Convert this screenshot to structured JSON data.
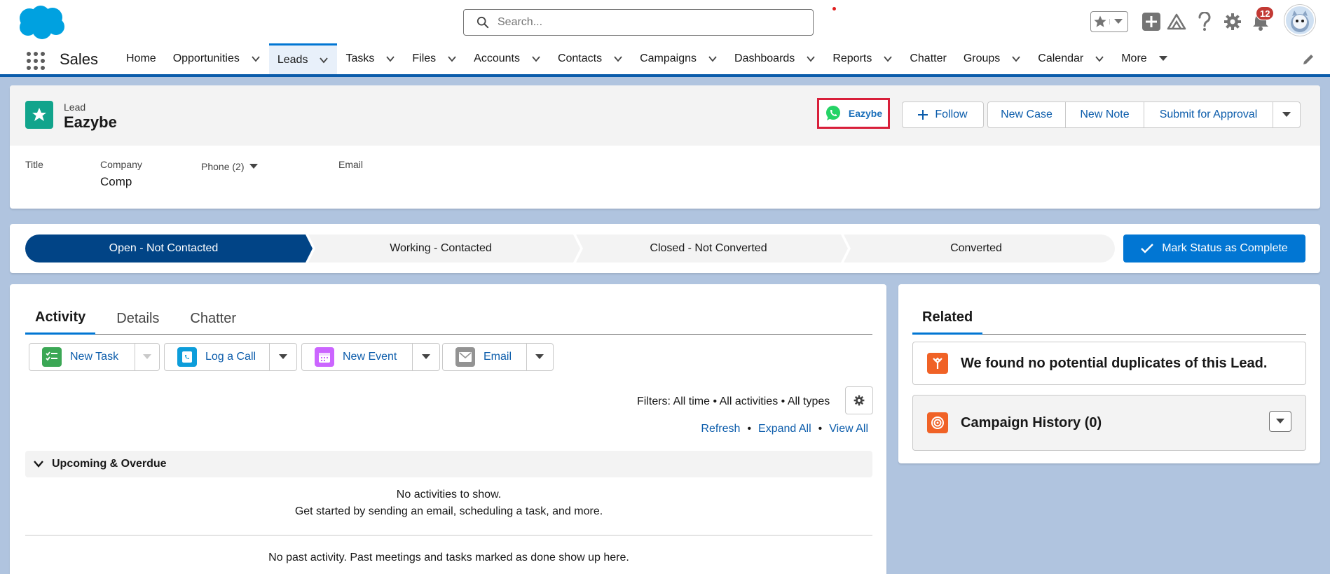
{
  "header": {
    "search_placeholder": "Search...",
    "notification_count": "12"
  },
  "nav": {
    "app_name": "Sales",
    "items": [
      {
        "label": "Home",
        "has_menu": false
      },
      {
        "label": "Opportunities",
        "has_menu": true
      },
      {
        "label": "Leads",
        "has_menu": true,
        "active": true
      },
      {
        "label": "Tasks",
        "has_menu": true
      },
      {
        "label": "Files",
        "has_menu": true
      },
      {
        "label": "Accounts",
        "has_menu": true
      },
      {
        "label": "Contacts",
        "has_menu": true
      },
      {
        "label": "Campaigns",
        "has_menu": true
      },
      {
        "label": "Dashboards",
        "has_menu": true
      },
      {
        "label": "Reports",
        "has_menu": true
      },
      {
        "label": "Chatter",
        "has_menu": false
      },
      {
        "label": "Groups",
        "has_menu": true
      },
      {
        "label": "Calendar",
        "has_menu": true
      },
      {
        "label": "More",
        "has_menu": true
      }
    ]
  },
  "record": {
    "type": "Lead",
    "name": "Eazybe",
    "eazybe_button": "Eazybe",
    "follow_label": "Follow",
    "actions": [
      "New Case",
      "New Note",
      "Submit for Approval"
    ],
    "fields": {
      "title_label": "Title",
      "company_label": "Company",
      "company_value": "Comp",
      "phone_label": "Phone (2)",
      "email_label": "Email"
    }
  },
  "path": {
    "stages": [
      {
        "label": "Open - Not Contacted",
        "current": true
      },
      {
        "label": "Working - Contacted",
        "current": false
      },
      {
        "label": "Closed - Not Converted",
        "current": false
      },
      {
        "label": "Converted",
        "current": false
      }
    ],
    "mark_complete": "Mark Status as Complete"
  },
  "activity": {
    "tabs": [
      "Activity",
      "Details",
      "Chatter"
    ],
    "actions": [
      "New Task",
      "Log a Call",
      "New Event",
      "Email"
    ],
    "filters": "Filters: All time • All activities • All types",
    "links": [
      "Refresh",
      "Expand All",
      "View All"
    ],
    "upcoming": "Upcoming & Overdue",
    "empty_line1": "No activities to show.",
    "empty_line2": "Get started by sending an email, scheduling a task, and more.",
    "past": "No past activity. Past meetings and tasks marked as done show up here."
  },
  "related": {
    "tab": "Related",
    "duplicates": "We found no potential duplicates of this Lead.",
    "campaign_history": "Campaign History (0)"
  },
  "colors": {
    "brand": "#0176d3",
    "path_current": "#014486",
    "lead_icon": "#11a48c",
    "highlight_border": "#d81f3a"
  }
}
